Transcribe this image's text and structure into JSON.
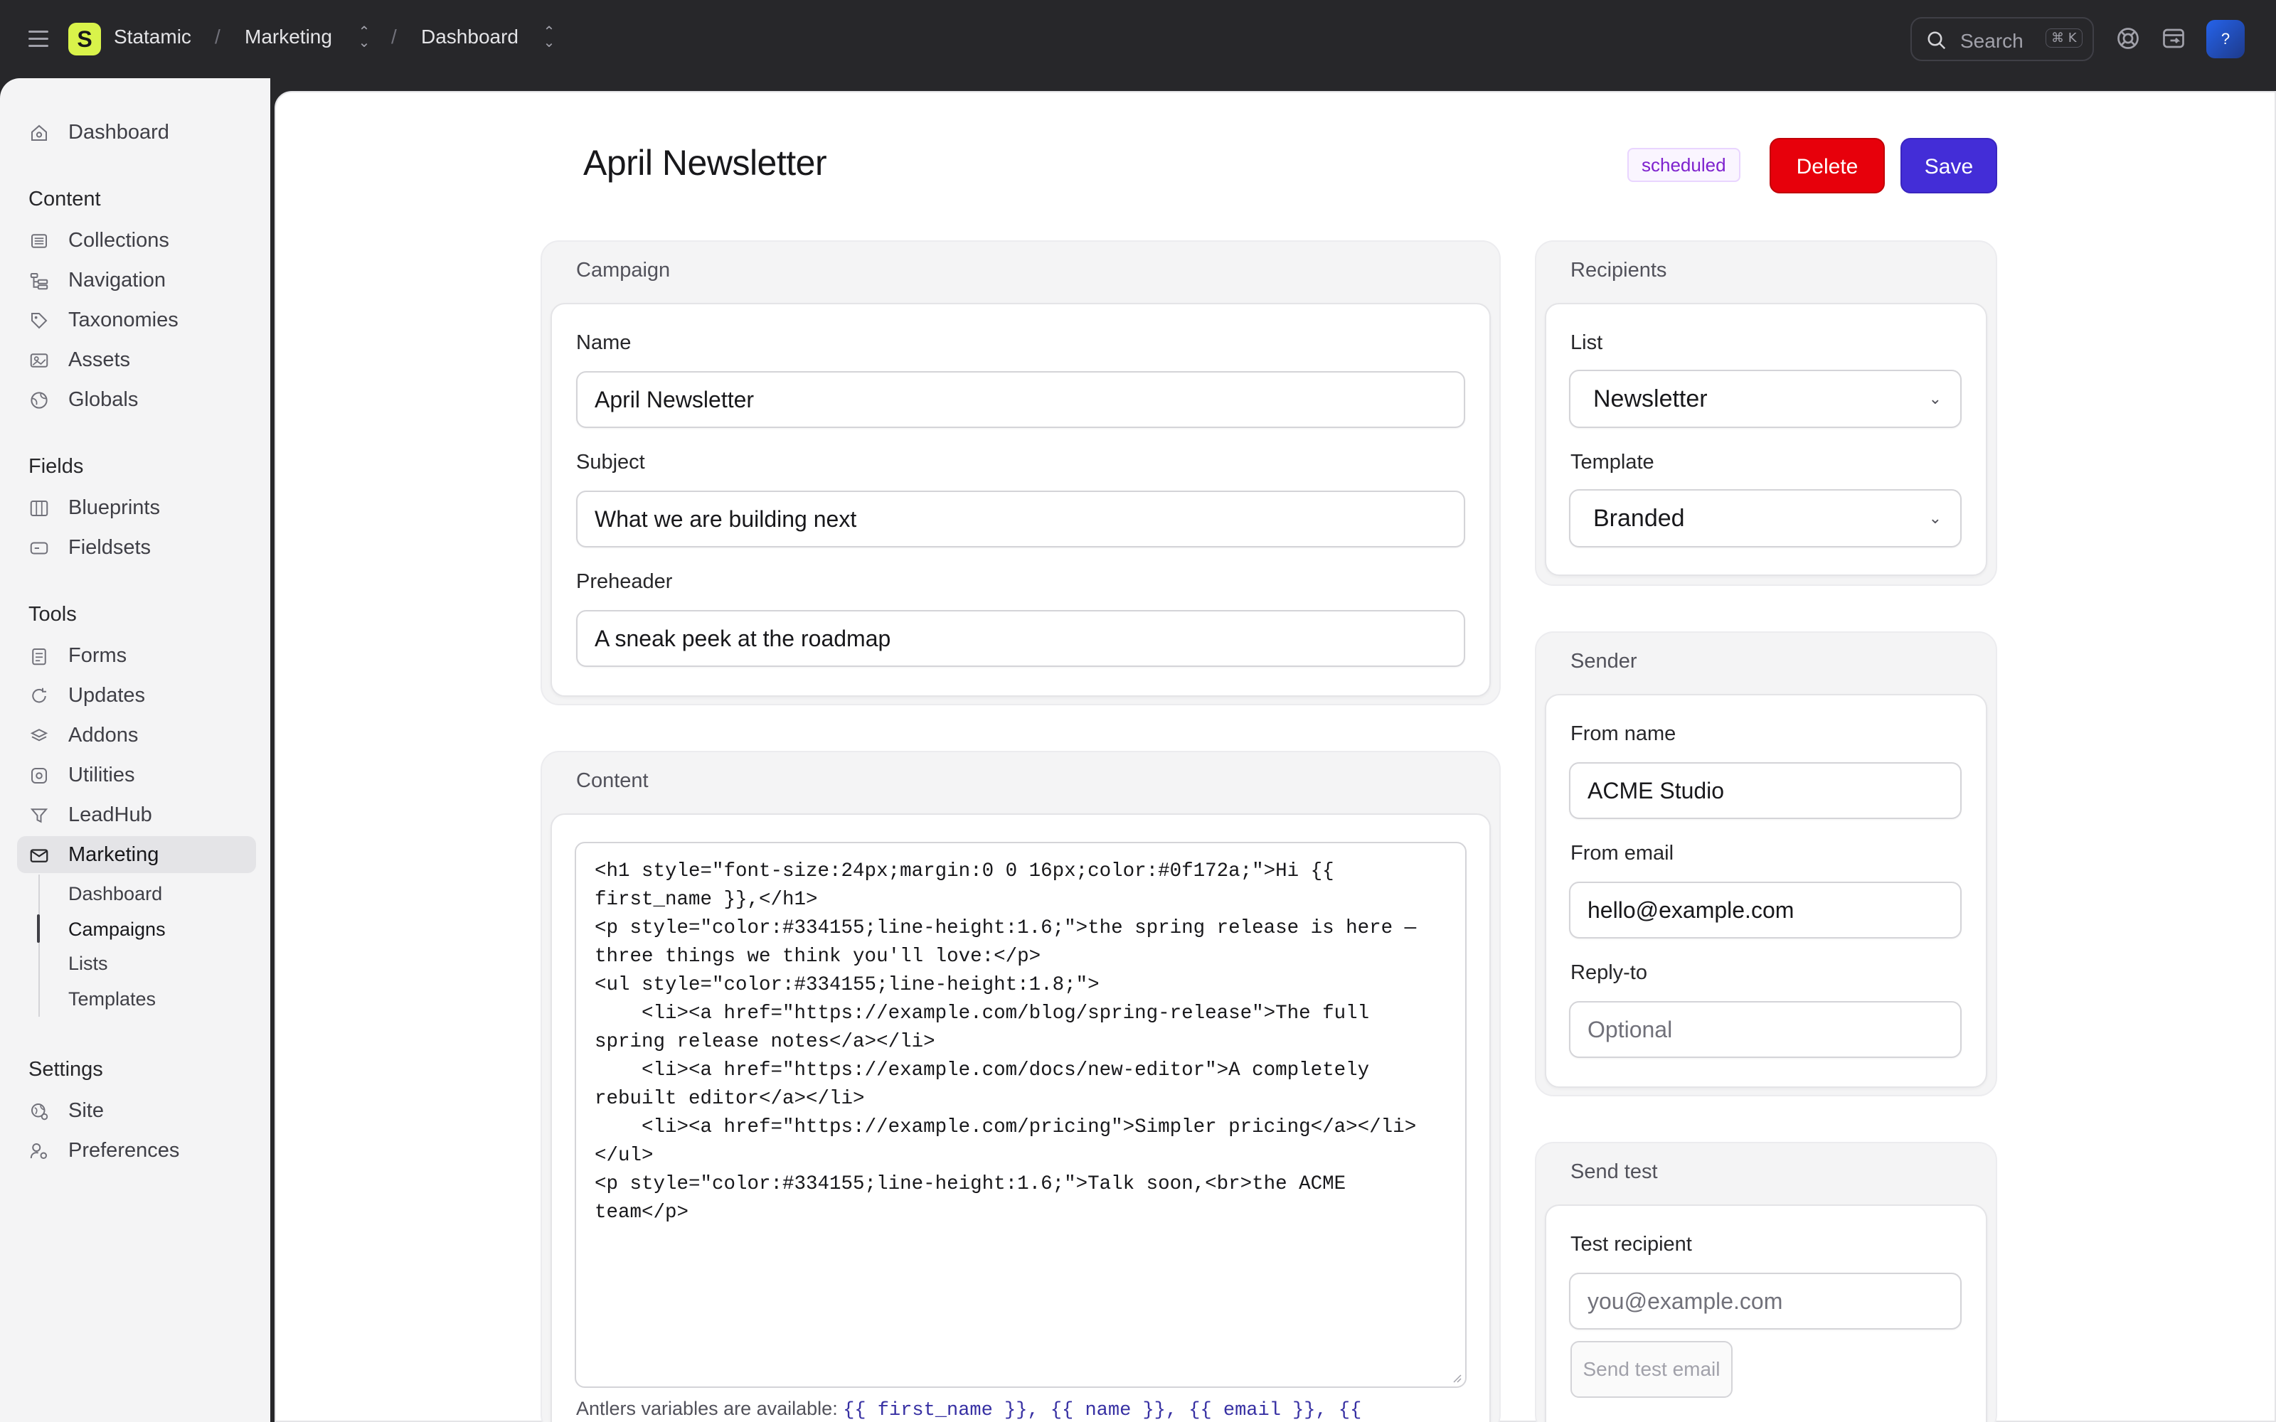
{
  "topbar": {
    "app_name": "Statamic",
    "logo_letter": "S",
    "breadcrumb_1": "Marketing",
    "breadcrumb_2": "Dashboard",
    "separator": "/",
    "search_label": "Search",
    "search_shortcut": "⌘ K",
    "avatar_label": "?"
  },
  "sidebar": {
    "dashboard": "Dashboard",
    "content_heading": "Content",
    "content_items": [
      "Collections",
      "Navigation",
      "Taxonomies",
      "Assets",
      "Globals"
    ],
    "fields_heading": "Fields",
    "fields_items": [
      "Blueprints",
      "Fieldsets"
    ],
    "tools_heading": "Tools",
    "tools_items": [
      "Forms",
      "Updates",
      "Addons",
      "Utilities",
      "LeadHub",
      "Marketing"
    ],
    "marketing_sub": [
      "Dashboard",
      "Campaigns",
      "Lists",
      "Templates"
    ],
    "settings_heading": "Settings",
    "settings_items": [
      "Site",
      "Preferences"
    ]
  },
  "page": {
    "title": "April Newsletter",
    "status_badge": "scheduled",
    "delete_label": "Delete",
    "save_label": "Save"
  },
  "campaign": {
    "heading": "Campaign",
    "name_label": "Name",
    "name_value": "April Newsletter",
    "subject_label": "Subject",
    "subject_value": "What we are building next",
    "preheader_label": "Preheader",
    "preheader_value": "A sneak peek at the roadmap"
  },
  "content": {
    "heading": "Content",
    "body": "<h1 style=\"font-size:24px;margin:0 0 16px;color:#0f172a;\">Hi {{ first_name }},</h1>\n<p style=\"color:#334155;line-height:1.6;\">the spring release is here — three things we think you'll love:</p>\n<ul style=\"color:#334155;line-height:1.8;\">\n    <li><a href=\"https://example.com/blog/spring-release\">The full spring release notes</a></li>\n    <li><a href=\"https://example.com/docs/new-editor\">A completely rebuilt editor</a></li>\n    <li><a href=\"https://example.com/pricing\">Simpler pricing</a></li>\n</ul>\n<p style=\"color:#334155;line-height:1.6;\">Talk soon,<br>the ACME team</p>",
    "note_prefix": "Antlers variables are available: ",
    "note_vars": "{{ first_name }}, {{ name }}, {{ email }}, {{"
  },
  "recipients": {
    "heading": "Recipients",
    "list_label": "List",
    "list_value": "Newsletter",
    "template_label": "Template",
    "template_value": "Branded"
  },
  "sender": {
    "heading": "Sender",
    "from_name_label": "From name",
    "from_name_value": "ACME Studio",
    "from_email_label": "From email",
    "from_email_value": "hello@example.com",
    "reply_to_label": "Reply-to",
    "reply_to_placeholder": "Optional"
  },
  "send_test": {
    "heading": "Send test",
    "recipient_label": "Test recipient",
    "recipient_placeholder": "you@example.com",
    "button_label": "Send test email"
  },
  "colors": {
    "accent": "#432dd7",
    "danger": "#e7000b",
    "logo": "#d9f34a",
    "badge_text": "#7e22ce"
  }
}
